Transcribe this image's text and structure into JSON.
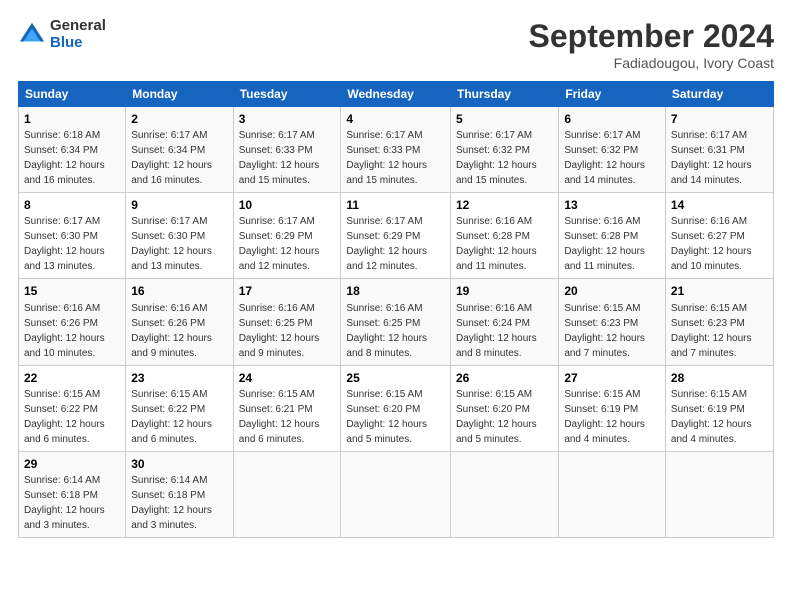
{
  "logo": {
    "general": "General",
    "blue": "Blue"
  },
  "title": "September 2024",
  "location": "Fadiadougou, Ivory Coast",
  "weekdays": [
    "Sunday",
    "Monday",
    "Tuesday",
    "Wednesday",
    "Thursday",
    "Friday",
    "Saturday"
  ],
  "weeks": [
    [
      {
        "day": "1",
        "sunrise": "6:18 AM",
        "sunset": "6:34 PM",
        "daylight": "12 hours and 16 minutes."
      },
      {
        "day": "2",
        "sunrise": "6:17 AM",
        "sunset": "6:34 PM",
        "daylight": "12 hours and 16 minutes."
      },
      {
        "day": "3",
        "sunrise": "6:17 AM",
        "sunset": "6:33 PM",
        "daylight": "12 hours and 15 minutes."
      },
      {
        "day": "4",
        "sunrise": "6:17 AM",
        "sunset": "6:33 PM",
        "daylight": "12 hours and 15 minutes."
      },
      {
        "day": "5",
        "sunrise": "6:17 AM",
        "sunset": "6:32 PM",
        "daylight": "12 hours and 15 minutes."
      },
      {
        "day": "6",
        "sunrise": "6:17 AM",
        "sunset": "6:32 PM",
        "daylight": "12 hours and 14 minutes."
      },
      {
        "day": "7",
        "sunrise": "6:17 AM",
        "sunset": "6:31 PM",
        "daylight": "12 hours and 14 minutes."
      }
    ],
    [
      {
        "day": "8",
        "sunrise": "6:17 AM",
        "sunset": "6:30 PM",
        "daylight": "12 hours and 13 minutes."
      },
      {
        "day": "9",
        "sunrise": "6:17 AM",
        "sunset": "6:30 PM",
        "daylight": "12 hours and 13 minutes."
      },
      {
        "day": "10",
        "sunrise": "6:17 AM",
        "sunset": "6:29 PM",
        "daylight": "12 hours and 12 minutes."
      },
      {
        "day": "11",
        "sunrise": "6:17 AM",
        "sunset": "6:29 PM",
        "daylight": "12 hours and 12 minutes."
      },
      {
        "day": "12",
        "sunrise": "6:16 AM",
        "sunset": "6:28 PM",
        "daylight": "12 hours and 11 minutes."
      },
      {
        "day": "13",
        "sunrise": "6:16 AM",
        "sunset": "6:28 PM",
        "daylight": "12 hours and 11 minutes."
      },
      {
        "day": "14",
        "sunrise": "6:16 AM",
        "sunset": "6:27 PM",
        "daylight": "12 hours and 10 minutes."
      }
    ],
    [
      {
        "day": "15",
        "sunrise": "6:16 AM",
        "sunset": "6:26 PM",
        "daylight": "12 hours and 10 minutes."
      },
      {
        "day": "16",
        "sunrise": "6:16 AM",
        "sunset": "6:26 PM",
        "daylight": "12 hours and 9 minutes."
      },
      {
        "day": "17",
        "sunrise": "6:16 AM",
        "sunset": "6:25 PM",
        "daylight": "12 hours and 9 minutes."
      },
      {
        "day": "18",
        "sunrise": "6:16 AM",
        "sunset": "6:25 PM",
        "daylight": "12 hours and 8 minutes."
      },
      {
        "day": "19",
        "sunrise": "6:16 AM",
        "sunset": "6:24 PM",
        "daylight": "12 hours and 8 minutes."
      },
      {
        "day": "20",
        "sunrise": "6:15 AM",
        "sunset": "6:23 PM",
        "daylight": "12 hours and 7 minutes."
      },
      {
        "day": "21",
        "sunrise": "6:15 AM",
        "sunset": "6:23 PM",
        "daylight": "12 hours and 7 minutes."
      }
    ],
    [
      {
        "day": "22",
        "sunrise": "6:15 AM",
        "sunset": "6:22 PM",
        "daylight": "12 hours and 6 minutes."
      },
      {
        "day": "23",
        "sunrise": "6:15 AM",
        "sunset": "6:22 PM",
        "daylight": "12 hours and 6 minutes."
      },
      {
        "day": "24",
        "sunrise": "6:15 AM",
        "sunset": "6:21 PM",
        "daylight": "12 hours and 6 minutes."
      },
      {
        "day": "25",
        "sunrise": "6:15 AM",
        "sunset": "6:20 PM",
        "daylight": "12 hours and 5 minutes."
      },
      {
        "day": "26",
        "sunrise": "6:15 AM",
        "sunset": "6:20 PM",
        "daylight": "12 hours and 5 minutes."
      },
      {
        "day": "27",
        "sunrise": "6:15 AM",
        "sunset": "6:19 PM",
        "daylight": "12 hours and 4 minutes."
      },
      {
        "day": "28",
        "sunrise": "6:15 AM",
        "sunset": "6:19 PM",
        "daylight": "12 hours and 4 minutes."
      }
    ],
    [
      {
        "day": "29",
        "sunrise": "6:14 AM",
        "sunset": "6:18 PM",
        "daylight": "12 hours and 3 minutes."
      },
      {
        "day": "30",
        "sunrise": "6:14 AM",
        "sunset": "6:18 PM",
        "daylight": "12 hours and 3 minutes."
      },
      null,
      null,
      null,
      null,
      null
    ]
  ],
  "labels": {
    "sunrise": "Sunrise:",
    "sunset": "Sunset:",
    "daylight": "Daylight: 12 hours"
  }
}
